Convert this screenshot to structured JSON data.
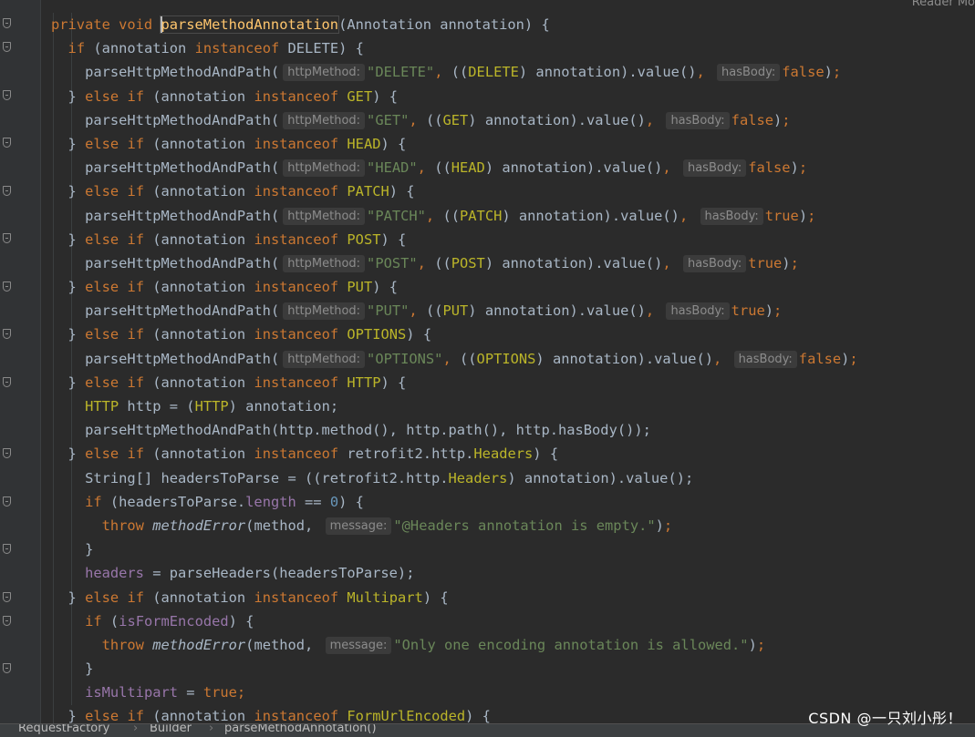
{
  "editor": {
    "reader_mode_label": "Reader Mo",
    "method_signature": {
      "modifiers": "private void ",
      "method_name": "parseMethodAnnotation",
      "params": "(Annotation annotation) {"
    },
    "kw": {
      "if": "if",
      "else": "else",
      "instanceof": "instanceof",
      "throw": "throw",
      "true": "true",
      "false": "false"
    },
    "call_name": "parseHttpMethodAndPath",
    "hints": {
      "httpMethod": "httpMethod:",
      "hasBody": "hasBody:",
      "message": "message:"
    },
    "annotation_branches": [
      {
        "annotation": "DELETE",
        "http_method": "\"DELETE\"",
        "has_body": "false"
      },
      {
        "annotation": "GET",
        "http_method": "\"GET\"",
        "has_body": "false"
      },
      {
        "annotation": "HEAD",
        "http_method": "\"HEAD\"",
        "has_body": "false"
      },
      {
        "annotation": "PATCH",
        "http_method": "\"PATCH\"",
        "has_body": "true"
      },
      {
        "annotation": "POST",
        "http_method": "\"POST\"",
        "has_body": "true"
      },
      {
        "annotation": "PUT",
        "http_method": "\"PUT\"",
        "has_body": "true"
      },
      {
        "annotation": "OPTIONS",
        "http_method": "\"OPTIONS\"",
        "has_body": "false"
      }
    ],
    "http_branch": {
      "annotation": "HTTP",
      "assign_tail": " http = (",
      "assign_end": ") annotation;",
      "call_tail": "(http.method(), http.path(), http.hasBody());"
    },
    "headers_branch": {
      "annotation_prefix": "retrofit2.http.",
      "annotation_name": "Headers",
      "decl": "String[] headersToParse = ((retrofit2.http.",
      "decl_end": ") annotation).value();",
      "cond_pre": " (headersToParse.",
      "length_field": "length",
      "cond_op": " == ",
      "zero": "0",
      "cond_end": ") {",
      "error_fn": "methodError",
      "method_arg": "(method, ",
      "error_message": "\"@Headers annotation is empty.\"",
      "assign_field": "headers",
      "assign_rhs": " = parseHeaders(headersToParse);"
    },
    "multipart_branch": {
      "annotation": "Multipart",
      "cond_var": "isFormEncoded",
      "error_message": "\"Only one encoding annotation is allowed.\"",
      "assign_field": "isMultipart"
    },
    "last_branch_annotation": "FormUrlEncoded"
  },
  "breadcrumb": {
    "items": [
      "RequestFactory",
      "Builder",
      "parseMethodAnnotation()"
    ],
    "separator": "›"
  },
  "watermark": "CSDN @一只刘小彤！"
}
